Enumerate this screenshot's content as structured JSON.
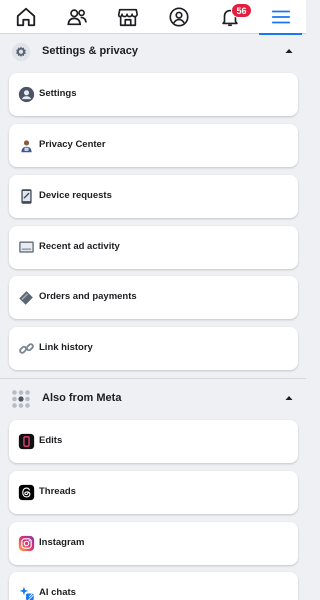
{
  "nav": {
    "items": [
      {
        "icon": "home-icon"
      },
      {
        "icon": "friends-icon"
      },
      {
        "icon": "marketplace-icon"
      },
      {
        "icon": "profile-icon"
      },
      {
        "icon": "notifications-icon",
        "badge": "56"
      },
      {
        "icon": "menu-icon",
        "active": true
      }
    ],
    "accent": "#1877f2",
    "badge_color": "#e41e3f"
  },
  "settings_section": {
    "title": "Settings & privacy",
    "items": [
      {
        "label": "Settings",
        "icon": "settings-avatar-icon"
      },
      {
        "label": "Privacy Center",
        "icon": "privacy-lock-icon"
      },
      {
        "label": "Device requests",
        "icon": "device-icon"
      },
      {
        "label": "Recent ad activity",
        "icon": "ad-activity-icon"
      },
      {
        "label": "Orders and payments",
        "icon": "payments-card-icon"
      },
      {
        "label": "Link history",
        "icon": "link-icon"
      }
    ]
  },
  "meta_section": {
    "title": "Also from Meta",
    "items": [
      {
        "label": "Edits",
        "icon": "edits-app-icon"
      },
      {
        "label": "Threads",
        "icon": "threads-app-icon"
      },
      {
        "label": "Instagram",
        "icon": "instagram-app-icon"
      },
      {
        "label": "AI chats",
        "icon": "ai-chats-icon"
      }
    ]
  }
}
